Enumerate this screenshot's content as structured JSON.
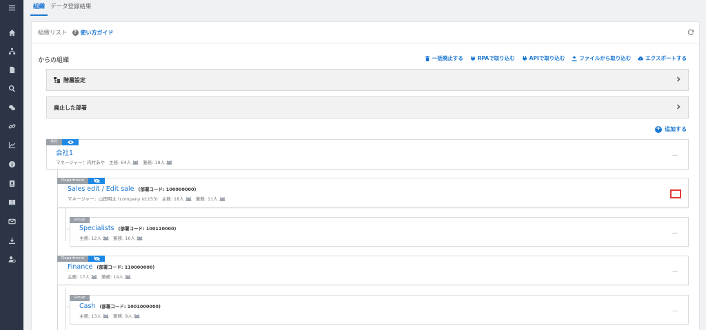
{
  "tabs": [
    {
      "label": "組織",
      "active": true
    },
    {
      "label": "データ登録結果",
      "active": false
    }
  ],
  "sidebar_icons": [
    "menu-icon",
    "home-icon",
    "org-chart-icon",
    "document-icon",
    "search-icon",
    "chat-icon",
    "link-icon",
    "chart-icon",
    "info-icon",
    "contact-card-icon",
    "book-icon",
    "mail-icon",
    "download-icon",
    "user-settings-icon"
  ],
  "panel": {
    "title": "組織リスト",
    "help_label": "使い方ガイド",
    "section_title": "からの組織",
    "actions": [
      {
        "label": "一括廃止する",
        "icon": "trash-icon"
      },
      {
        "label": "RPAで取り込む",
        "icon": "plug-icon"
      },
      {
        "label": "APIで取り込む",
        "icon": "plug-icon"
      },
      {
        "label": "ファイルから取り込む",
        "icon": "upload-icon"
      },
      {
        "label": "エクスポートする",
        "icon": "cloud-download-icon"
      }
    ],
    "collapse_hierarchy": "階層設定",
    "collapse_abolished": "廃止した部署",
    "add_label": "追加する"
  },
  "org_root": {
    "badge": "全社",
    "name": "会社1",
    "manager": "マネージャー：内村あや",
    "primary": "主務: 64人",
    "concurrent": "兼務: 18人"
  },
  "departments": [
    {
      "badge": "Department",
      "name": "Sales edit / Edit sale",
      "code": "(部署コード: 100000000)",
      "manager": "マネージャー：山田明太 (company id:153)",
      "primary": "主務: 18人",
      "concurrent": "兼務: 11人"
    },
    {
      "badge": "Group",
      "name": "Specialists",
      "code": "(部署コード: 100110000)",
      "primary": "主務: 12人",
      "concurrent": "兼務: 16人"
    },
    {
      "badge": "Department",
      "name": "Finance",
      "code": "(部署コード: 110000000)",
      "primary": "主務: 17人",
      "concurrent": "兼務: 14人"
    },
    {
      "badge": "Group",
      "name": "Cash",
      "code": "(部署コード: 1001000000)",
      "primary": "主務: 13人",
      "concurrent": "兼務: 9人"
    }
  ],
  "more_glyph": "...",
  "colors": {
    "accent": "#1976d2",
    "sidebar": "#2b3545",
    "highlight": "#e53935"
  }
}
